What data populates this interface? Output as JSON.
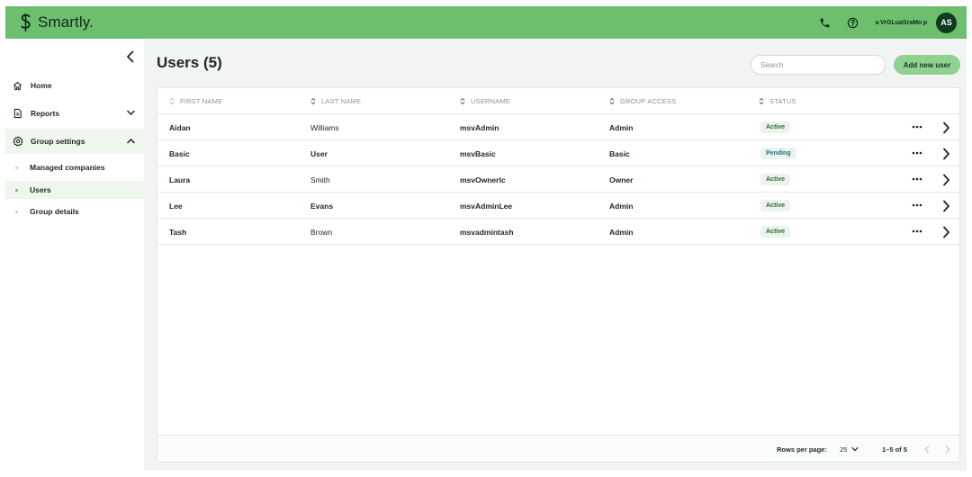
{
  "brand": {
    "name": "Smartly.",
    "accent": "#6dbf6d"
  },
  "topbar": {
    "phone_icon": "phone-icon",
    "help_icon": "help-circle-icon",
    "user_name": "u VrGLuaSraMo p",
    "avatar_initials": "AS"
  },
  "sidebar": {
    "collapse_icon": "chevron-left-icon",
    "items": [
      {
        "label": "Home",
        "icon": "home-icon"
      },
      {
        "label": "Reports",
        "icon": "document-icon",
        "chevron": "chevron-down-icon"
      },
      {
        "label": "Group settings",
        "icon": "gear-icon",
        "chevron": "chevron-up-icon"
      }
    ],
    "subitems": [
      {
        "label": "Managed companies"
      },
      {
        "label": "Users"
      },
      {
        "label": "Group details"
      }
    ]
  },
  "main": {
    "title": "Users (5)",
    "search_placeholder": "Search",
    "add_button": "Add new user"
  },
  "table": {
    "columns": [
      "FIRST NAME",
      "LAST NAME",
      "USERNAME",
      "GROUP ACCESS",
      "STATUS"
    ],
    "rows": [
      {
        "first": "Aidan",
        "last": "Williams",
        "username": "msvAdmin",
        "access": "Admin",
        "status": "Active"
      },
      {
        "first": "Basic",
        "last": "User",
        "username": "msvBasic",
        "access": "Basic",
        "status": "Pending"
      },
      {
        "first": "Laura",
        "last": "Smith",
        "username": "msvOwnerlc",
        "access": "Owner",
        "status": "Active"
      },
      {
        "first": "Lee",
        "last": "Evans",
        "username": "msvAdminLee",
        "access": "Admin",
        "status": "Active"
      },
      {
        "first": "Tash",
        "last": "Brown",
        "username": "msvadmintash",
        "access": "Admin",
        "status": "Active"
      }
    ],
    "more_icon": "more-horizontal-icon",
    "row_arrow_icon": "chevron-right-icon"
  },
  "pagination": {
    "rows_per_page_label": "Rows per page:",
    "rows_per_page_value": "25",
    "range": "1–5 of 5"
  }
}
